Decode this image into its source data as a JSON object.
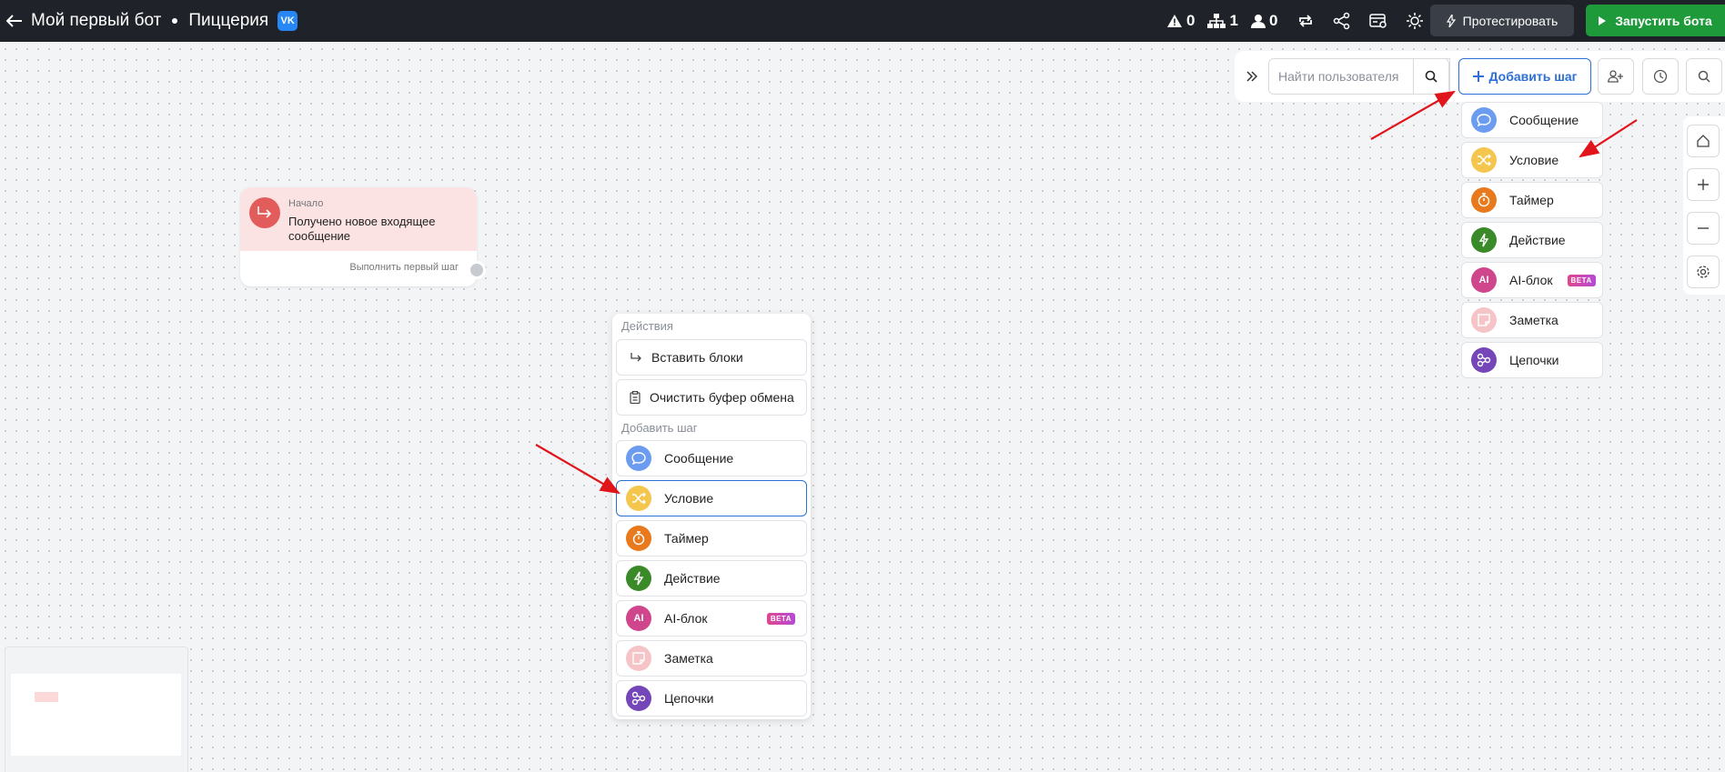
{
  "topbar": {
    "bot_name": "Мой первый бот",
    "project_name": "Пиццерия",
    "vk_label": "VK",
    "stats": {
      "warnings": "0",
      "structure": "1",
      "users": "0"
    },
    "test_label": "Протестировать",
    "run_label": "Запустить бота"
  },
  "toolbar": {
    "search_placeholder": "Найти пользователя",
    "add_step_label": "Добавить шаг"
  },
  "step_types": [
    {
      "label": "Сообщение",
      "color": "#6b9cf0",
      "icon": "message-icon"
    },
    {
      "label": "Условие",
      "color": "#f4c64e",
      "icon": "shuffle-icon"
    },
    {
      "label": "Таймер",
      "color": "#e8791c",
      "icon": "timer-icon"
    },
    {
      "label": "Действие",
      "color": "#3a8a2a",
      "icon": "lightning-icon"
    },
    {
      "label": "AI-блок",
      "color": "#d0468c",
      "icon": "ai-icon",
      "icon_text": "AI",
      "badge": "BETA"
    },
    {
      "label": "Заметка",
      "color": "#f6c3c6",
      "icon": "note-icon"
    },
    {
      "label": "Цепочки",
      "color": "#7446b8",
      "icon": "chain-icon"
    }
  ],
  "start_node": {
    "label": "Начало",
    "text": "Получено новое входящее сообщение",
    "footer": "Выполнить первый шаг"
  },
  "context_menu": {
    "actions_title": "Действия",
    "paste_label": "Вставить блоки",
    "clear_label": "Очистить буфер обмена",
    "add_title": "Добавить шаг",
    "selected_index": 1
  },
  "colors": {
    "accent": "#2c6fd6",
    "topbar_bg": "#1f2329",
    "run_button": "#1f9a3b",
    "arrow": "#e0151b"
  }
}
